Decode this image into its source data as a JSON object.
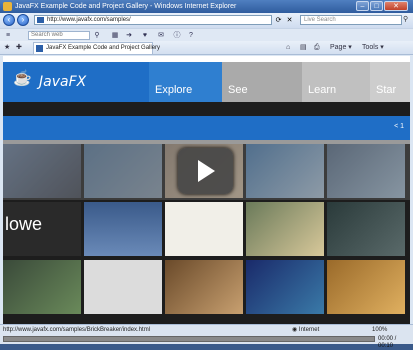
{
  "window": {
    "title": "JavaFX Example Code and Project Gallery - Windows Internet Explorer",
    "min_label": "–",
    "max_label": "□",
    "close_label": "✕"
  },
  "address": {
    "url": "http://www.javafx.com/samples/",
    "search_placeholder": "Live Search"
  },
  "toolbar": {
    "search_placeholder": "Search web"
  },
  "tab": {
    "title": "JavaFX Example Code and Project Gallery",
    "page_label": "Page",
    "tools_label": "Tools"
  },
  "site": {
    "logo_text": "JavaFX",
    "nav": [
      "Explore",
      "See",
      "Learn",
      "Star"
    ],
    "bluebar_nav": "< 1"
  },
  "tiles": {
    "label_row2": "lowe"
  },
  "status": {
    "text": "http://www.javafx.com/samples/BrickBreaker/index.html",
    "zone": "Internet",
    "zoom": "100%",
    "time": "00:00 / 00:10",
    "progress": 0.0
  },
  "colors": {
    "javafx_blue": "#1f6ec6",
    "titlebar": "#2f5c9e"
  }
}
